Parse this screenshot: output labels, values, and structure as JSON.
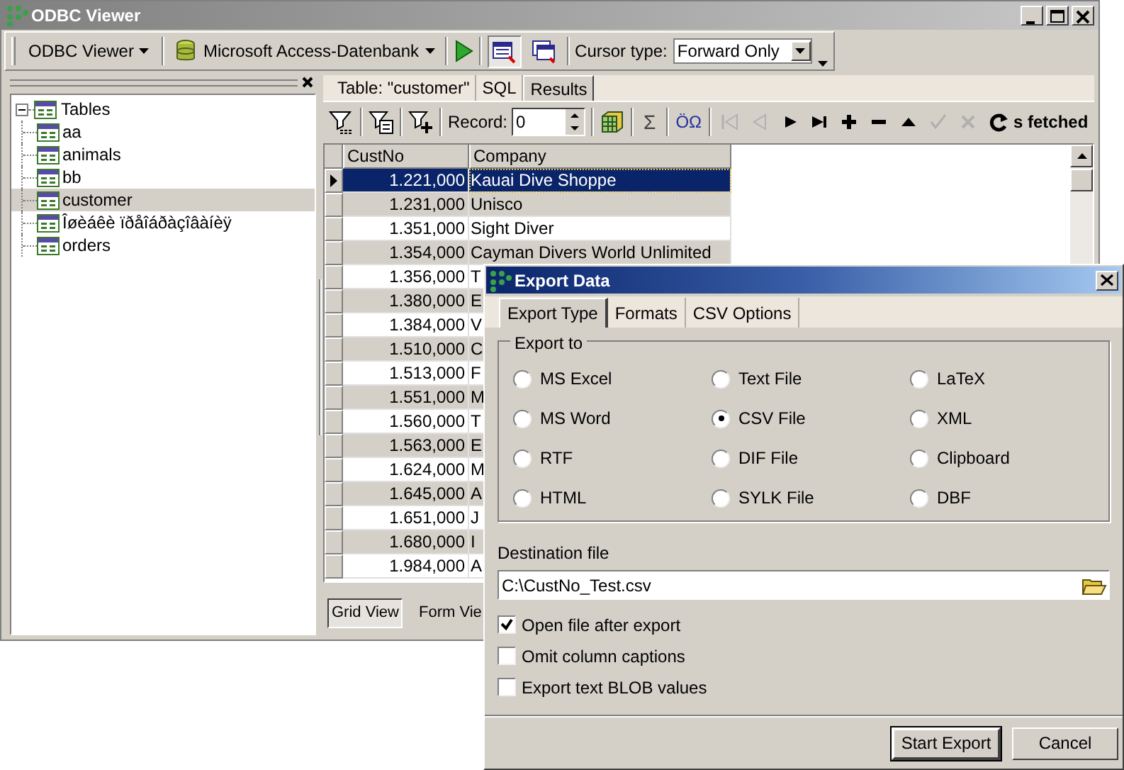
{
  "window": {
    "title": "ODBC Viewer"
  },
  "toolbar": {
    "connection_menu": "ODBC Viewer",
    "database_menu": "Microsoft Access-Datenbank",
    "grid_buttons": [
      {
        "pressed": true
      },
      {
        "pressed": false
      }
    ],
    "cursor_label": "Cursor type:",
    "cursor_value": "Forward Only"
  },
  "tree": {
    "root": "Tables",
    "expanded": true,
    "children": [
      {
        "label": "aa",
        "selected": false
      },
      {
        "label": "animals",
        "selected": false
      },
      {
        "label": "bb",
        "selected": false
      },
      {
        "label": "customer",
        "selected": true
      },
      {
        "label": "Îøèáêè ïðåîáðàçîâàíèÿ",
        "selected": false
      },
      {
        "label": "orders",
        "selected": false
      }
    ]
  },
  "tabs": [
    {
      "label": "Table: \"customer\"",
      "selected": false
    },
    {
      "label": "SQL",
      "selected": false
    },
    {
      "label": "Results",
      "selected": true
    }
  ],
  "record_toolbar": {
    "record_label": "Record:",
    "record_value": "0",
    "sum_button": "Σ",
    "charset_button": "ÖΩ",
    "fetched_label": "s fetched",
    "nav_buttons": [
      {
        "kind": "first",
        "disabled": true
      },
      {
        "kind": "prev",
        "disabled": true
      },
      {
        "kind": "next",
        "disabled": false
      },
      {
        "kind": "last",
        "disabled": false
      },
      {
        "kind": "insert",
        "disabled": false
      },
      {
        "kind": "delete",
        "disabled": false
      },
      {
        "kind": "edit",
        "disabled": false
      },
      {
        "kind": "post",
        "disabled": true
      },
      {
        "kind": "cancel",
        "disabled": true
      }
    ]
  },
  "grid": {
    "columns": [
      "CustNo",
      "Company"
    ],
    "rows": [
      {
        "custno": "1.221,000",
        "company": "Kauai Dive Shoppe",
        "selected": true
      },
      {
        "custno": "1.231,000",
        "company": "Unisco",
        "selected": false
      },
      {
        "custno": "1.351,000",
        "company": "Sight Diver",
        "selected": false
      },
      {
        "custno": "1.354,000",
        "company": "Cayman Divers World Unlimited",
        "selected": false
      },
      {
        "custno": "1.356,000",
        "company": "T",
        "selected": false
      },
      {
        "custno": "1.380,000",
        "company": "E",
        "selected": false
      },
      {
        "custno": "1.384,000",
        "company": "V",
        "selected": false
      },
      {
        "custno": "1.510,000",
        "company": "C",
        "selected": false
      },
      {
        "custno": "1.513,000",
        "company": "F",
        "selected": false
      },
      {
        "custno": "1.551,000",
        "company": "M",
        "selected": false
      },
      {
        "custno": "1.560,000",
        "company": "T",
        "selected": false
      },
      {
        "custno": "1.563,000",
        "company": "E",
        "selected": false
      },
      {
        "custno": "1.624,000",
        "company": "M",
        "selected": false
      },
      {
        "custno": "1.645,000",
        "company": "A",
        "selected": false
      },
      {
        "custno": "1.651,000",
        "company": "J",
        "selected": false
      },
      {
        "custno": "1.680,000",
        "company": "I",
        "selected": false
      },
      {
        "custno": "1.984,000",
        "company": "A",
        "selected": false
      }
    ]
  },
  "view_buttons": [
    {
      "label": "Grid View",
      "selected": true
    },
    {
      "label": "Form Vie",
      "selected": false
    }
  ],
  "dialog": {
    "title": "Export Data",
    "tabs": [
      {
        "label": "Export Type",
        "selected": true
      },
      {
        "label": "Formats",
        "selected": false
      },
      {
        "label": "CSV Options",
        "selected": false
      }
    ],
    "group_title": "Export to",
    "formats": [
      {
        "label": "MS Excel",
        "selected": false
      },
      {
        "label": "Text File",
        "selected": false
      },
      {
        "label": "LaTeX",
        "selected": false
      },
      {
        "label": "MS Word",
        "selected": false
      },
      {
        "label": "CSV File",
        "selected": true
      },
      {
        "label": "XML",
        "selected": false
      },
      {
        "label": "RTF",
        "selected": false
      },
      {
        "label": "DIF File",
        "selected": false
      },
      {
        "label": "Clipboard",
        "selected": false
      },
      {
        "label": "HTML",
        "selected": false
      },
      {
        "label": "SYLK File",
        "selected": false
      },
      {
        "label": "DBF",
        "selected": false
      }
    ],
    "destination_label": "Destination file",
    "destination_value": "C:\\CustNo_Test.csv",
    "options": [
      {
        "label": "Open file after export",
        "checked": true
      },
      {
        "label": "Omit column captions",
        "checked": false
      },
      {
        "label": "Export text BLOB values",
        "checked": false
      }
    ],
    "buttons": [
      "Start Export",
      "Cancel"
    ]
  }
}
